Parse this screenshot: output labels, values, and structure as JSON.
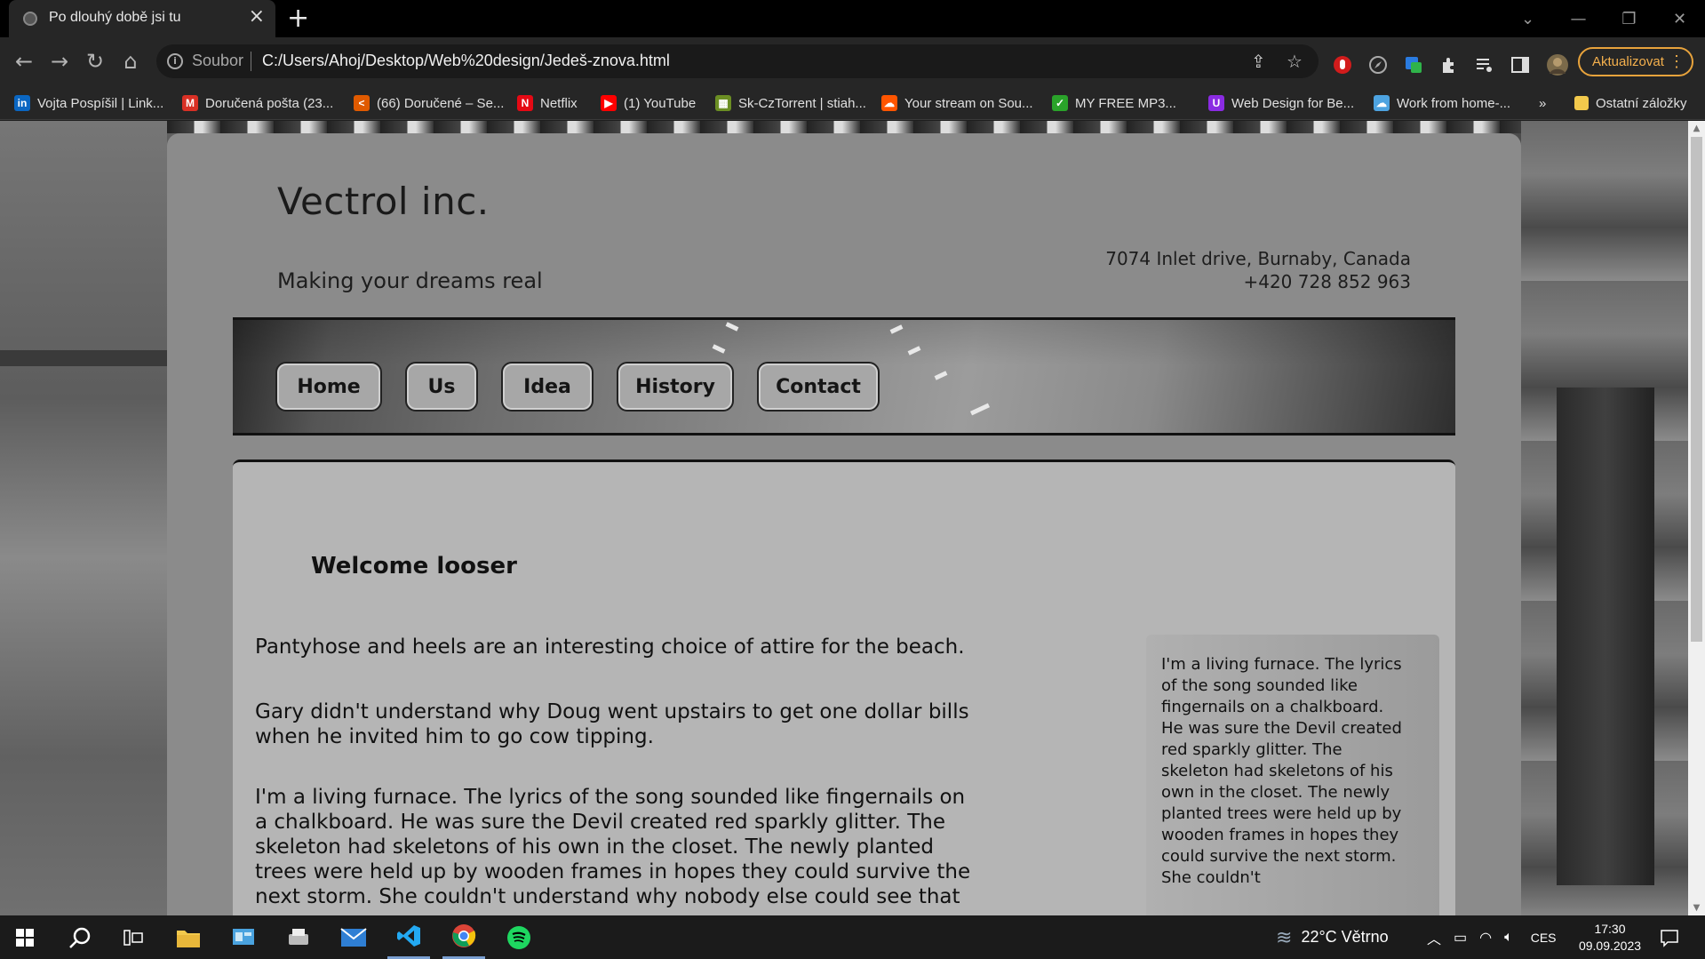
{
  "browser": {
    "tab_title": "Po dlouhý době jsi tu",
    "tab_close": "×",
    "new_tab": "+",
    "soubor_label": "Soubor",
    "url": "C:/Users/Ahoj/Desktop/Web%20design/Jedeš-znova.html",
    "update_label": "Aktualizovat",
    "bookmarks": [
      {
        "label": "Vojta Pospíšil | Link...",
        "icon": "linkedin-icon",
        "color": "#0a66c2",
        "glyph": "in"
      },
      {
        "label": "Doručená pošta (23...",
        "icon": "gmail-icon",
        "color": "#d93025",
        "glyph": "M"
      },
      {
        "label": "(66) Doručené – Se...",
        "icon": "seznam-icon",
        "color": "#e05a00",
        "glyph": "<"
      },
      {
        "label": "Netflix",
        "icon": "netflix-icon",
        "color": "#e50914",
        "glyph": "N"
      },
      {
        "label": "(1) YouTube",
        "icon": "youtube-icon",
        "color": "#ff0000",
        "glyph": "▶"
      },
      {
        "label": "Sk-CzTorrent | stiah...",
        "icon": "torrent-icon",
        "color": "#6b8e23",
        "glyph": "▦"
      },
      {
        "label": "Your stream on Sou...",
        "icon": "soundcloud-icon",
        "color": "#ff5500",
        "glyph": "☁"
      },
      {
        "label": "MY FREE MP3...",
        "icon": "mp3-icon",
        "color": "#2aa32a",
        "glyph": "✓"
      },
      {
        "label": "Web Design for Be...",
        "icon": "udemy-icon",
        "color": "#8a2be2",
        "glyph": "U"
      },
      {
        "label": "Work from home-...",
        "icon": "cloud-icon",
        "color": "#4da3e0",
        "glyph": "☁"
      }
    ],
    "bookmarks_more": "»",
    "other_bookmarks": "Ostatní záložky"
  },
  "site": {
    "title": "Vectrol inc.",
    "tagline": "Making your dreams real",
    "address_line1": "7074 Inlet drive, Burnaby, Canada",
    "address_line2": "+420 728 852 963",
    "nav": [
      "Home",
      "Us",
      "Idea",
      "History",
      "Contact"
    ],
    "welcome": "Welcome looser",
    "paragraphs": [
      "Pantyhose and heels are an interesting choice of attire for the beach.",
      "Gary didn't understand why Doug went upstairs to get one dollar bills when he invited him to go cow tipping.",
      "I'm a living furnace. The lyrics of the song sounded like fingernails on a chalkboard. He was sure the Devil created red sparkly glitter. The skeleton had skeletons of his own in the closet. The newly planted trees were held up by wooden frames in hopes they could survive the next storm. She couldn't understand why nobody else could see that"
    ],
    "aside": "I'm a living furnace. The lyrics of the song sounded like fingernails on a chalkboard. He was sure the Devil created red sparkly glitter. The skeleton had skeletons of his own in the closet. The newly planted trees were held up by wooden frames in hopes they could survive the next storm. She couldn't"
  },
  "taskbar": {
    "weather": "22°C  Větrno",
    "language": "CES",
    "time": "17:30",
    "date": "09.09.2023"
  },
  "colors": {
    "accent_update": "#e8a33c",
    "card_bg": "#8b8b8b",
    "content_bg": "#b5b5b5"
  }
}
